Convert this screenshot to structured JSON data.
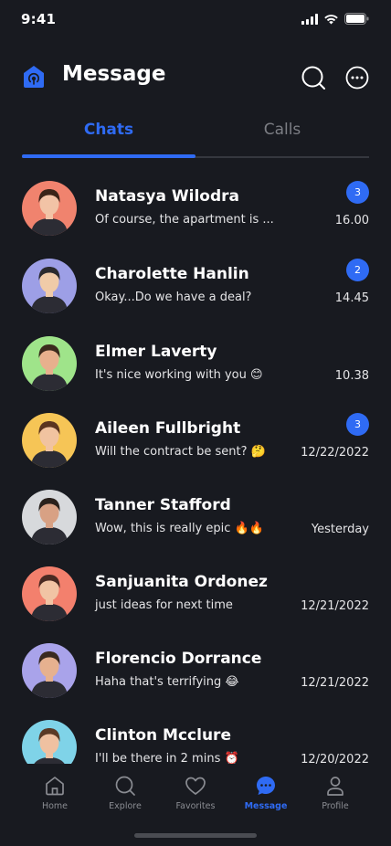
{
  "status_bar": {
    "time": "9:41"
  },
  "header": {
    "title": "Message",
    "search_icon": "search-icon",
    "more_icon": "more-horizontal-icon"
  },
  "tabs": [
    {
      "label": "Chats",
      "active": true
    },
    {
      "label": "Calls",
      "active": false
    }
  ],
  "chats": [
    {
      "name": "Natasya Wilodra",
      "message": "Of course, the apartment is ...",
      "time": "16.00",
      "unread": "3",
      "avatar_bg": "#f0836e",
      "skin": "#f2c3a6",
      "hair": "#3a2418"
    },
    {
      "name": "Charolette Hanlin",
      "message": "Okay...Do we have a deal?",
      "time": "14.45",
      "unread": "2",
      "avatar_bg": "#9d9fe6",
      "skin": "#f0cba8",
      "hair": "#2a2a2e"
    },
    {
      "name": "Elmer Laverty",
      "message": "It's nice working with you 😊",
      "time": "10.38",
      "unread": "",
      "avatar_bg": "#9fe48a",
      "skin": "#e7b08d",
      "hair": "#3b2a1d"
    },
    {
      "name": "Aileen Fullbright",
      "message": "Will the contract be sent? 🤔",
      "time": "12/22/2022",
      "unread": "3",
      "avatar_bg": "#f6c556",
      "skin": "#f1c3a0",
      "hair": "#5b3420"
    },
    {
      "name": "Tanner Stafford",
      "message": "Wow, this is really epic 🔥🔥",
      "time": "Yesterday",
      "unread": "",
      "avatar_bg": "#d7d9dc",
      "skin": "#d8a184",
      "hair": "#2a211c"
    },
    {
      "name": "Sanjuanita Ordonez",
      "message": "just ideas for next time",
      "time": "12/21/2022",
      "unread": "",
      "avatar_bg": "#f3806d",
      "skin": "#f1c4a4",
      "hair": "#4a2a22"
    },
    {
      "name": "Florencio Dorrance",
      "message": "Haha that's terrifying 😂",
      "time": "12/21/2022",
      "unread": "",
      "avatar_bg": "#a9a3ea",
      "skin": "#e6b18f",
      "hair": "#3a2a1f"
    },
    {
      "name": "Clinton Mcclure",
      "message": "I'll be there in 2 mins ⏰",
      "time": "12/20/2022",
      "unread": "",
      "avatar_bg": "#7fd3e8",
      "skin": "#efc1a1",
      "hair": "#5a3a26"
    }
  ],
  "nav": [
    {
      "label": "Home",
      "icon": "home-icon",
      "active": false
    },
    {
      "label": "Explore",
      "icon": "explore-icon",
      "active": false
    },
    {
      "label": "Favorites",
      "icon": "heart-icon",
      "active": false
    },
    {
      "label": "Message",
      "icon": "message-icon",
      "active": true
    },
    {
      "label": "Profile",
      "icon": "profile-icon",
      "active": false
    }
  ],
  "colors": {
    "accent": "#2f6bf4",
    "background": "#181a20",
    "divider": "#35383f",
    "muted": "#7c7e84"
  }
}
